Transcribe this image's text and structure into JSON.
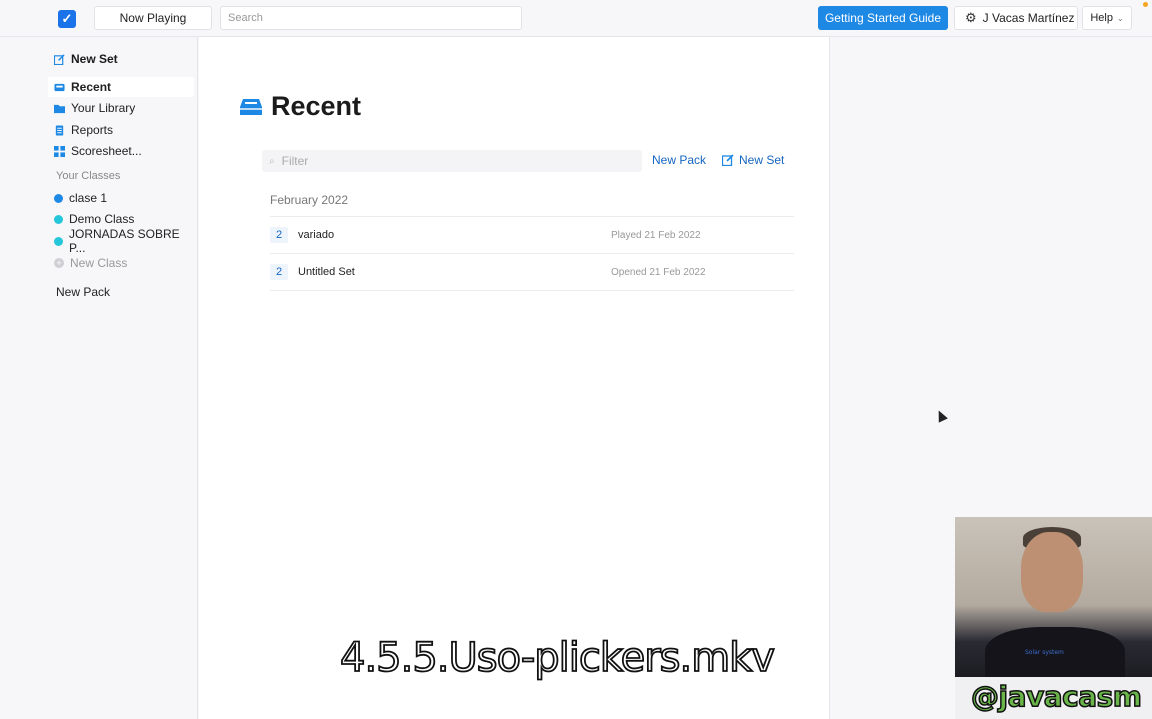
{
  "header": {
    "now_playing_label": "Now Playing",
    "search_placeholder": "Search",
    "getting_started_label": "Getting Started Guide",
    "user_name": "J Vacas Martínez",
    "help_label": "Help"
  },
  "sidebar": {
    "new_set_label": "New Set",
    "items": [
      {
        "label": "Recent",
        "icon": "inbox-icon"
      },
      {
        "label": "Your Library",
        "icon": "folder-icon"
      },
      {
        "label": "Reports",
        "icon": "document-icon"
      },
      {
        "label": "Scoresheet...",
        "icon": "grid-icon"
      }
    ],
    "classes_heading": "Your Classes",
    "classes": [
      {
        "label": "clase 1",
        "color": "#1e88e5"
      },
      {
        "label": "Demo Class",
        "color": "#26c6da"
      },
      {
        "label": "JORNADAS SOBRE P...",
        "color": "#26c6da"
      }
    ],
    "new_class_label": "New Class",
    "new_pack_label": "New Pack"
  },
  "main": {
    "title": "Recent",
    "filter_placeholder": "Filter",
    "new_pack_label": "New Pack",
    "new_set_label": "New Set",
    "group_label": "February 2022",
    "rows": [
      {
        "count": "2",
        "name": "variado",
        "meta": "Played 21 Feb 2022"
      },
      {
        "count": "2",
        "name": "Untitled Set",
        "meta": "Opened 21 Feb 2022"
      }
    ]
  },
  "overlay": {
    "caption": "4.5.5.Uso-plickers.mkv",
    "handle": "@javacasm",
    "shirt_text": "Solar system"
  },
  "colors": {
    "accent": "#1e88e5",
    "link": "#1565c0"
  }
}
